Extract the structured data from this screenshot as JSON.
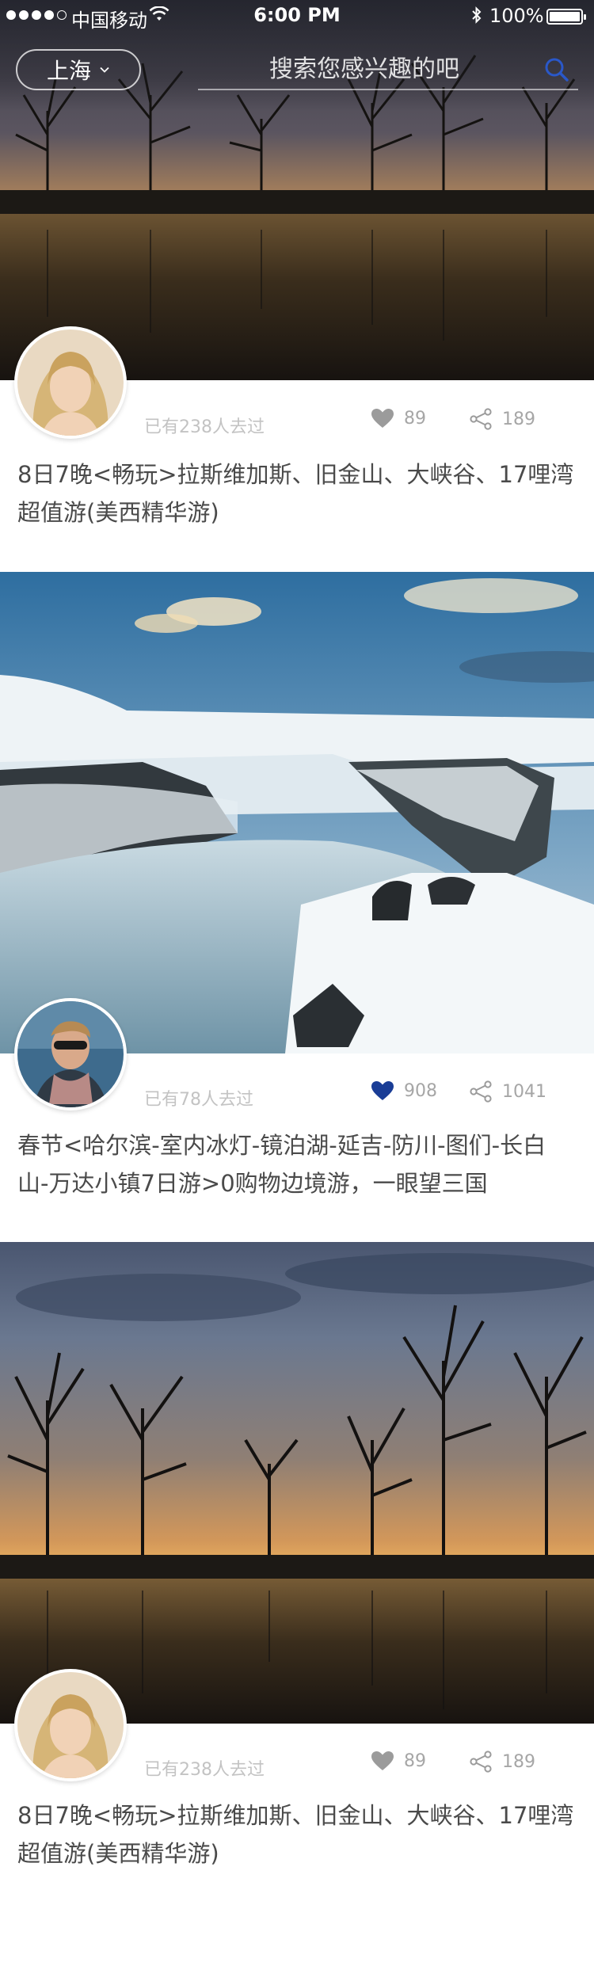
{
  "status_bar": {
    "carrier": "中国移动",
    "time": "6:00 PM",
    "battery": "100%"
  },
  "header": {
    "city": "上海",
    "search_placeholder": "搜索您感兴趣的吧"
  },
  "cards": [
    {
      "visited": "已有238人去过",
      "likes": "89",
      "shares": "189",
      "liked": false,
      "title": "8日7晚<畅玩>拉斯维加斯、旧金山、大峡谷、17哩湾超值游(美西精华游)"
    },
    {
      "visited": "已有78人去过",
      "likes": "908",
      "shares": "1041",
      "liked": true,
      "title": "春节<哈尔滨-室内冰灯-镜泊湖-延吉-防川-图们-长白山-万达小镇7日游>0购物边境游，一眼望三国"
    },
    {
      "visited": "已有238人去过",
      "likes": "89",
      "shares": "189",
      "liked": false,
      "title": "8日7晚<畅玩>拉斯维加斯、旧金山、大峡谷、17哩湾超值游(美西精华游)"
    }
  ],
  "colors": {
    "liked_heart": "#1a3d96",
    "unliked_heart": "#9b9b9b",
    "search_icon": "#2a58c9",
    "title_text": "#4a4a4a",
    "meta_text": "#c3c3c3"
  }
}
